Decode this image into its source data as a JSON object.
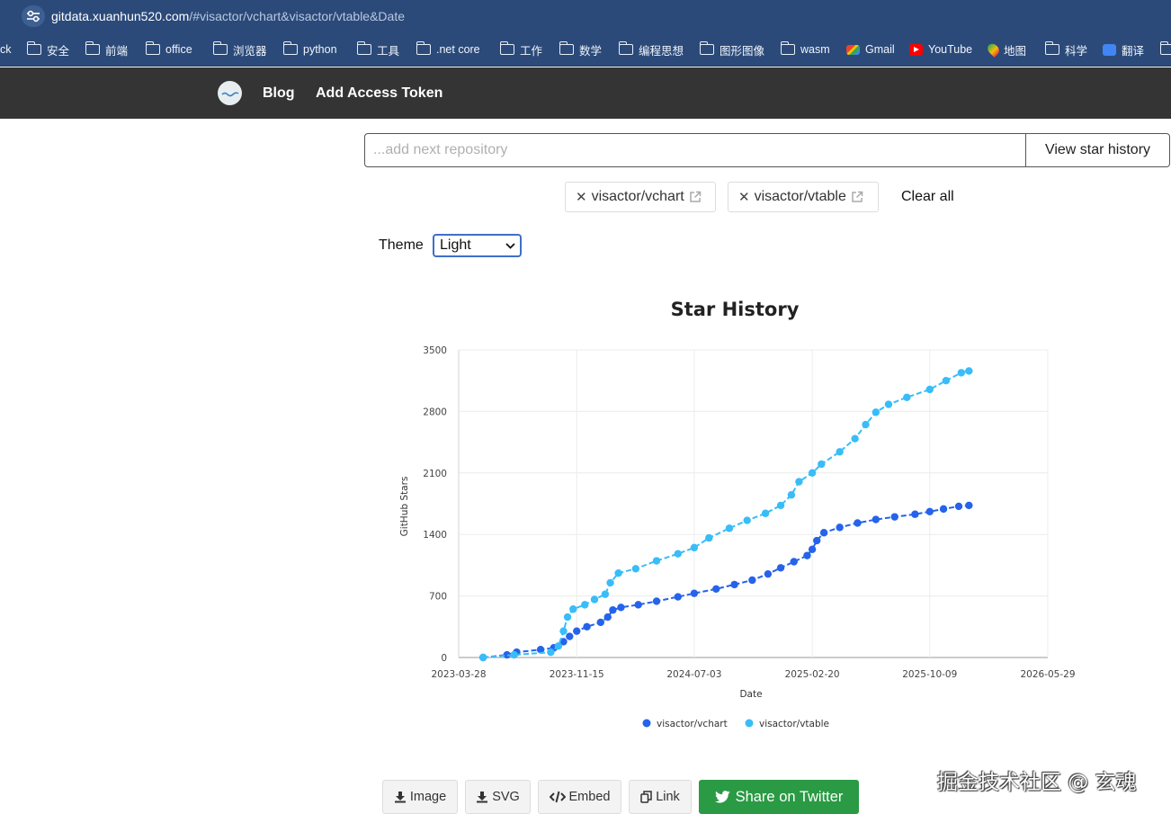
{
  "browser": {
    "url_host": "gitdata.xuanhun520.com",
    "url_path": "/#visactor/vchart&visactor/vtable&Date",
    "bookmarks": [
      {
        "label": "ck",
        "icon": "none"
      },
      {
        "label": "安全",
        "icon": "folder-icon"
      },
      {
        "label": "前端",
        "icon": "folder-icon"
      },
      {
        "label": "office",
        "icon": "folder-icon"
      },
      {
        "label": "浏览器",
        "icon": "folder-icon"
      },
      {
        "label": "python",
        "icon": "folder-icon"
      },
      {
        "label": "工具",
        "icon": "folder-icon"
      },
      {
        "label": ".net core",
        "icon": "folder-icon"
      },
      {
        "label": "工作",
        "icon": "folder-icon"
      },
      {
        "label": "数学",
        "icon": "folder-icon"
      },
      {
        "label": "编程思想",
        "icon": "folder-icon"
      },
      {
        "label": "图形图像",
        "icon": "folder-icon"
      },
      {
        "label": "wasm",
        "icon": "folder-icon"
      },
      {
        "label": "Gmail",
        "icon": "gmail-icon"
      },
      {
        "label": "YouTube",
        "icon": "youtube-icon"
      },
      {
        "label": "地图",
        "icon": "maps-icon"
      },
      {
        "label": "科学",
        "icon": "folder-icon"
      },
      {
        "label": "翻译",
        "icon": "translate-icon"
      }
    ]
  },
  "nav": {
    "blog": "Blog",
    "token": "Add Access Token"
  },
  "search": {
    "placeholder": "...add next repository",
    "button": "View star history"
  },
  "repos": [
    {
      "name": "visactor/vchart",
      "color": "#2563eb"
    },
    {
      "name": "visactor/vtable",
      "color": "#38bdf8"
    }
  ],
  "clear_all": "Clear all",
  "theme": {
    "label": "Theme",
    "selected": "Light"
  },
  "chart_data": {
    "type": "line",
    "title": "Star History",
    "xlabel": "Date",
    "ylabel": "GitHub Stars",
    "x_ticks": [
      "2023-03-28",
      "2023-11-15",
      "2024-07-03",
      "2025-02-20",
      "2025-10-09",
      "2026-05-29"
    ],
    "y_ticks": [
      0,
      700,
      1400,
      2100,
      2800,
      3500
    ],
    "ylim": [
      0,
      3500
    ],
    "xlim": [
      "2023-03-28",
      "2026-05-29"
    ],
    "grid": true,
    "legend": "bottom",
    "series": [
      {
        "name": "visactor/vchart",
        "color": "#2563eb",
        "points": [
          [
            "2023-05-15",
            0
          ],
          [
            "2023-07-01",
            30
          ],
          [
            "2023-07-20",
            60
          ],
          [
            "2023-09-05",
            90
          ],
          [
            "2023-10-01",
            110
          ],
          [
            "2023-10-20",
            180
          ],
          [
            "2023-11-01",
            240
          ],
          [
            "2023-11-15",
            300
          ],
          [
            "2023-12-05",
            350
          ],
          [
            "2024-01-01",
            400
          ],
          [
            "2024-01-15",
            460
          ],
          [
            "2024-01-25",
            540
          ],
          [
            "2024-02-10",
            570
          ],
          [
            "2024-03-15",
            600
          ],
          [
            "2024-04-20",
            640
          ],
          [
            "2024-06-01",
            690
          ],
          [
            "2024-07-03",
            730
          ],
          [
            "2024-08-15",
            780
          ],
          [
            "2024-09-20",
            830
          ],
          [
            "2024-10-25",
            880
          ],
          [
            "2024-11-25",
            950
          ],
          [
            "2024-12-20",
            1020
          ],
          [
            "2025-01-15",
            1090
          ],
          [
            "2025-02-10",
            1160
          ],
          [
            "2025-02-20",
            1230
          ],
          [
            "2025-03-01",
            1330
          ],
          [
            "2025-03-15",
            1420
          ],
          [
            "2025-04-15",
            1480
          ],
          [
            "2025-05-20",
            1530
          ],
          [
            "2025-06-25",
            1570
          ],
          [
            "2025-08-01",
            1600
          ],
          [
            "2025-09-10",
            1630
          ],
          [
            "2025-10-09",
            1660
          ],
          [
            "2025-11-05",
            1690
          ],
          [
            "2025-12-05",
            1720
          ],
          [
            "2025-12-25",
            1730
          ]
        ]
      },
      {
        "name": "visactor/vtable",
        "color": "#38bdf8",
        "points": [
          [
            "2023-05-15",
            0
          ],
          [
            "2023-07-15",
            30
          ],
          [
            "2023-09-25",
            60
          ],
          [
            "2023-10-10",
            130
          ],
          [
            "2023-10-20",
            300
          ],
          [
            "2023-10-28",
            460
          ],
          [
            "2023-11-08",
            550
          ],
          [
            "2023-12-01",
            600
          ],
          [
            "2023-12-20",
            660
          ],
          [
            "2024-01-10",
            720
          ],
          [
            "2024-01-20",
            850
          ],
          [
            "2024-02-05",
            960
          ],
          [
            "2024-03-10",
            1010
          ],
          [
            "2024-04-20",
            1100
          ],
          [
            "2024-06-01",
            1180
          ],
          [
            "2024-07-03",
            1250
          ],
          [
            "2024-08-01",
            1360
          ],
          [
            "2024-09-10",
            1470
          ],
          [
            "2024-10-15",
            1560
          ],
          [
            "2024-11-20",
            1640
          ],
          [
            "2024-12-20",
            1730
          ],
          [
            "2025-01-10",
            1850
          ],
          [
            "2025-01-25",
            2000
          ],
          [
            "2025-02-20",
            2100
          ],
          [
            "2025-03-10",
            2200
          ],
          [
            "2025-04-15",
            2340
          ],
          [
            "2025-05-15",
            2490
          ],
          [
            "2025-06-05",
            2650
          ],
          [
            "2025-06-25",
            2790
          ],
          [
            "2025-07-20",
            2880
          ],
          [
            "2025-08-25",
            2960
          ],
          [
            "2025-10-09",
            3050
          ],
          [
            "2025-11-10",
            3150
          ],
          [
            "2025-12-10",
            3240
          ],
          [
            "2025-12-25",
            3260
          ]
        ]
      }
    ]
  },
  "actions": {
    "image": "Image",
    "svg": "SVG",
    "embed": "Embed",
    "link": "Link",
    "twitter": "Share on Twitter"
  },
  "watermark": "掘金技术社区 @ 玄魂"
}
